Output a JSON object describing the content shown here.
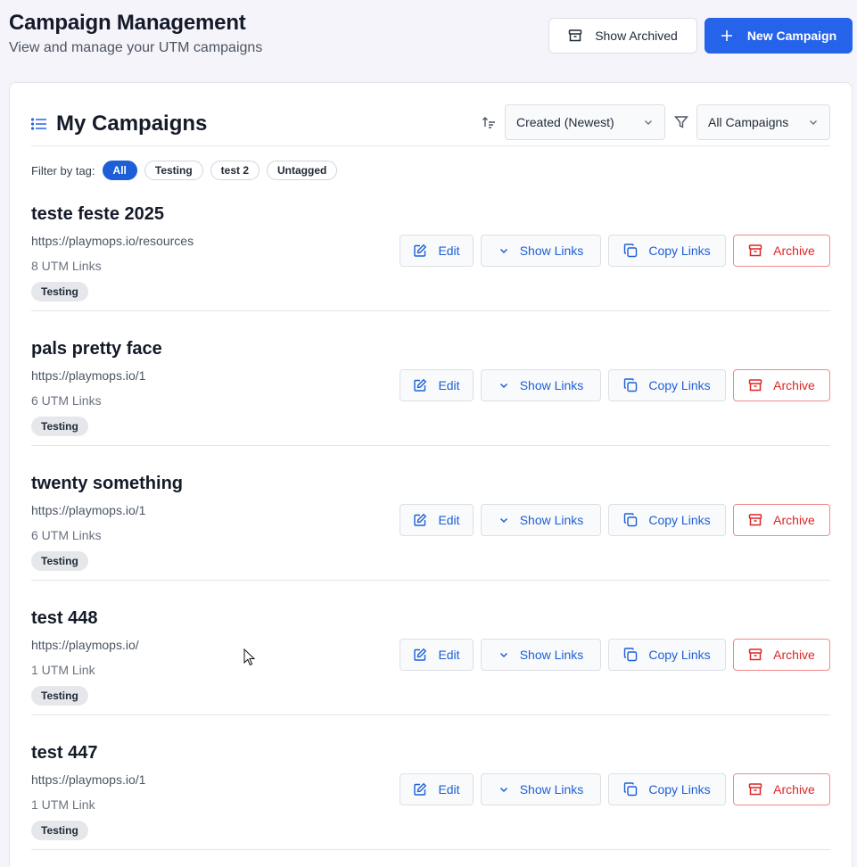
{
  "header": {
    "title": "Campaign Management",
    "subtitle": "View and manage your UTM campaigns",
    "show_archived_label": "Show Archived",
    "new_campaign_label": "New Campaign"
  },
  "list": {
    "title": "My Campaigns",
    "sort_value": "Created (Newest)",
    "filter_value": "All Campaigns",
    "filter_label": "Filter by tag:",
    "tags": [
      "All",
      "Testing",
      "test 2",
      "Untagged"
    ]
  },
  "actions": {
    "edit": "Edit",
    "show_links": "Show Links",
    "copy_links": "Copy Links",
    "archive": "Archive"
  },
  "campaigns": [
    {
      "name": "teste feste 2025",
      "url": "https://playmops.io/resources",
      "links": "8 UTM Links",
      "tag": "Testing"
    },
    {
      "name": "pals pretty face",
      "url": "https://playmops.io/1",
      "links": "6 UTM Links",
      "tag": "Testing"
    },
    {
      "name": "twenty something",
      "url": "https://playmops.io/1",
      "links": "6 UTM Links",
      "tag": "Testing"
    },
    {
      "name": "test 448",
      "url": "https://playmops.io/",
      "links": "1 UTM Link",
      "tag": "Testing"
    },
    {
      "name": "test 447",
      "url": "https://playmops.io/1",
      "links": "1 UTM Link",
      "tag": "Testing"
    }
  ],
  "colors": {
    "primary": "#2563eb",
    "link_blue": "#1d5fd6",
    "danger": "#dc2626",
    "background": "#f6f4fb"
  },
  "icons": [
    "archive-icon",
    "plus-icon",
    "list-icon",
    "sort-icon",
    "chevron-down-icon",
    "filter-icon",
    "edit-icon",
    "copy-icon",
    "cursor-icon"
  ]
}
